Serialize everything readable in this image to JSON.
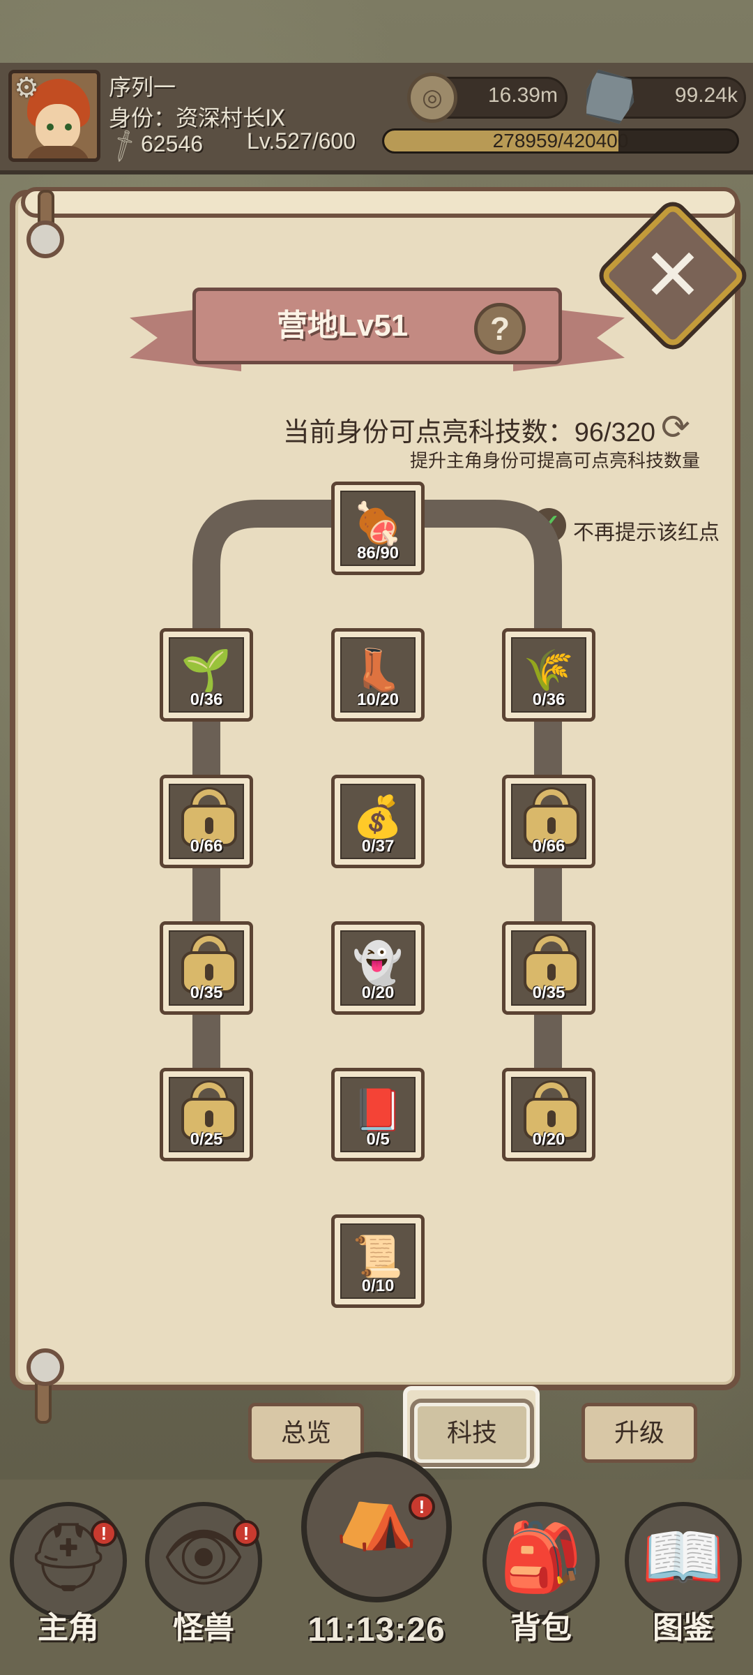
{
  "player": {
    "name": "序列一",
    "title": "身份：资深村长Ⅸ",
    "power": "62546",
    "level": "Lv.527/600"
  },
  "resources": {
    "coins": "16.39m",
    "gems": "99.24k"
  },
  "exp": {
    "text": "278959/420400",
    "fraction": 0.6635
  },
  "panel": {
    "title": "营地Lv51",
    "help_icon": "?",
    "close_icon": "✕",
    "tech_count": "当前身份可点亮科技数：96/320",
    "tech_hint": "提升主角身份可提高可点亮科技数量",
    "no_reminder": "不再提示该红点"
  },
  "tree": {
    "root": {
      "icon": "meat",
      "progress": "86/90"
    },
    "rows": [
      [
        {
          "icon": "soil-sprout",
          "progress": "0/36"
        },
        {
          "icon": "boot",
          "progress": "10/20"
        },
        {
          "icon": "hay-bundle",
          "progress": "0/36"
        }
      ],
      [
        {
          "icon": "lock",
          "progress": "0/66"
        },
        {
          "icon": "sack",
          "progress": "0/37"
        },
        {
          "icon": "lock",
          "progress": "0/66"
        }
      ],
      [
        {
          "icon": "lock",
          "progress": "0/35"
        },
        {
          "icon": "hooded-figure",
          "progress": "0/20"
        },
        {
          "icon": "lock",
          "progress": "0/35"
        }
      ],
      [
        {
          "icon": "lock",
          "progress": "0/25"
        },
        {
          "icon": "red-book",
          "progress": "0/5"
        },
        {
          "icon": "lock",
          "progress": "0/20"
        }
      ]
    ],
    "leaf": {
      "icon": "scroll-map",
      "progress": "0/10"
    }
  },
  "tabs": {
    "overview": "总览",
    "tech": "科技",
    "upgrade": "升级"
  },
  "nav": {
    "hero": "主角",
    "monster": "怪兽",
    "bag": "背包",
    "codex": "图鉴",
    "clock": "11:13:26"
  },
  "colors": {
    "parchment": "#e8dcc0",
    "frame": "#6f5140",
    "ribbon": "#c38a82",
    "badge": "#c93a2f"
  }
}
